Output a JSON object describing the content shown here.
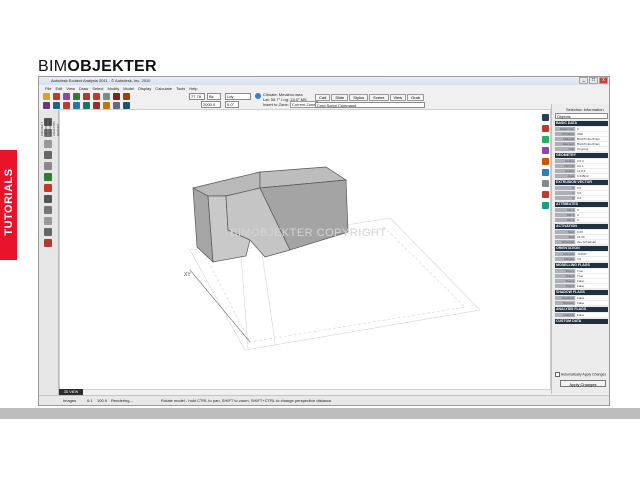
{
  "brand": {
    "light": "BIM",
    "bold": "OBJEKTER"
  },
  "side_banner": "TUTORIALS",
  "window": {
    "title": "Autodesk Ecotect Analysis 2011 - © Autodesk, Inc. 2010"
  },
  "menu": [
    "File",
    "Edit",
    "View",
    "Draw",
    "Select",
    "Modify",
    "Model",
    "Display",
    "Calculate",
    "Tools",
    "Help"
  ],
  "toolbar": {
    "zoom_value": "77.78",
    "unit_field": "Bk",
    "layer_field": "Ldy",
    "offset_value": "2000.0",
    "angle_value": "0.0°",
    "climate_line1": "Climate: Mmalmo.wea",
    "climate_line2": "Lat: 55.7°   Lng: 13.0°  MS",
    "zone_label": "Insert to Zone:",
    "zone_value": "Current Zone",
    "zone_sub": "Rename",
    "script_label": "Cmd Script Command",
    "tabs": [
      "Cad",
      "Slide",
      "Stylus",
      "Scene",
      "View",
      "Grab"
    ]
  },
  "left_tabs": [
    "PROJECT",
    "3D EDITOR",
    "VISUALISE",
    "ANALYSIS",
    "REPORT"
  ],
  "viewport": {
    "watermark": "BIMOBJEKTER COPYRIGHT",
    "axis_label": "XY"
  },
  "status": {
    "s1": "Images",
    "s2": "0:1",
    "s3": "100.9",
    "s4": "Rendering...",
    "hint": "Rotate model - hold CTRL to pan, SHIFT to zoom, SHIFT+CTRL to change perspective distance.",
    "tab": "3D VIEW"
  },
  "selection_panel": {
    "title": "Selection Information",
    "dropdown": "Objects",
    "sections": [
      {
        "title": "BASIC DATA",
        "rows": [
          [
            "Object No.",
            "0"
          ],
          [
            "Primitive",
            "Wall"
          ],
          [
            "Material",
            "BrickTimberFram"
          ],
          [
            "Element",
            "BrickTimberFram"
          ],
          [
            "Link",
            "Ongoing"
          ]
        ]
      },
      {
        "title": "GEOMETRY",
        "rows": [
          [
            "Centre",
            "0,0,0"
          ],
          [
            "Normal",
            "0,0,1"
          ],
          [
            "Extent",
            "12,8,3"
          ],
          [
            "Area",
            "0.448m2"
          ]
        ]
      },
      {
        "title": "EXTRUSION VECTOR",
        "rows": [
          [
            "X",
            "0.0"
          ],
          [
            "Y",
            "0.0"
          ],
          [
            "Z",
            "0.0"
          ]
        ]
      },
      {
        "title": "ATTRIBUTES",
        "rows": [
          [
            "Attr 1",
            "0"
          ],
          [
            "Attr 2",
            "0"
          ],
          [
            "Attr 3",
            "0"
          ]
        ]
      },
      {
        "title": "ACTIVATION",
        "rows": [
          [
            "Start",
            "0.00"
          ],
          [
            "End",
            "24.00"
          ],
          [
            "Schedule",
            "(No Schedule)"
          ]
        ]
      },
      {
        "title": "ORIENTATION",
        "rows": [
          [
            "Azimuth",
            "-0.000°"
          ],
          [
            "Altitude",
            "0.0"
          ]
        ]
      },
      {
        "title": "MODELLING FLAGS",
        "rows": [
          [
            "Flag 1",
            "True"
          ],
          [
            "Flag 2",
            "True"
          ],
          [
            "Flag 3",
            "False"
          ],
          [
            "Flag 4",
            "False"
          ]
        ]
      },
      {
        "title": "SHADOW FLAGS",
        "rows": [
          [
            "Shadows",
            "False"
          ],
          [
            "Receive",
            "False"
          ]
        ]
      },
      {
        "title": "ANALYSIS FLAGS",
        "rows": [
          [
            "Analysis",
            "False"
          ]
        ]
      },
      {
        "title": "CUSTOM DATA",
        "rows": []
      }
    ],
    "auto_apply": "Automatically Apply Changes",
    "apply_button": "Apply Changes"
  },
  "colors": {
    "accent_red": "#e8132a",
    "panel_header": "#223140",
    "building_face": "#c8c8c8",
    "building_side": "#a2a2a2"
  }
}
